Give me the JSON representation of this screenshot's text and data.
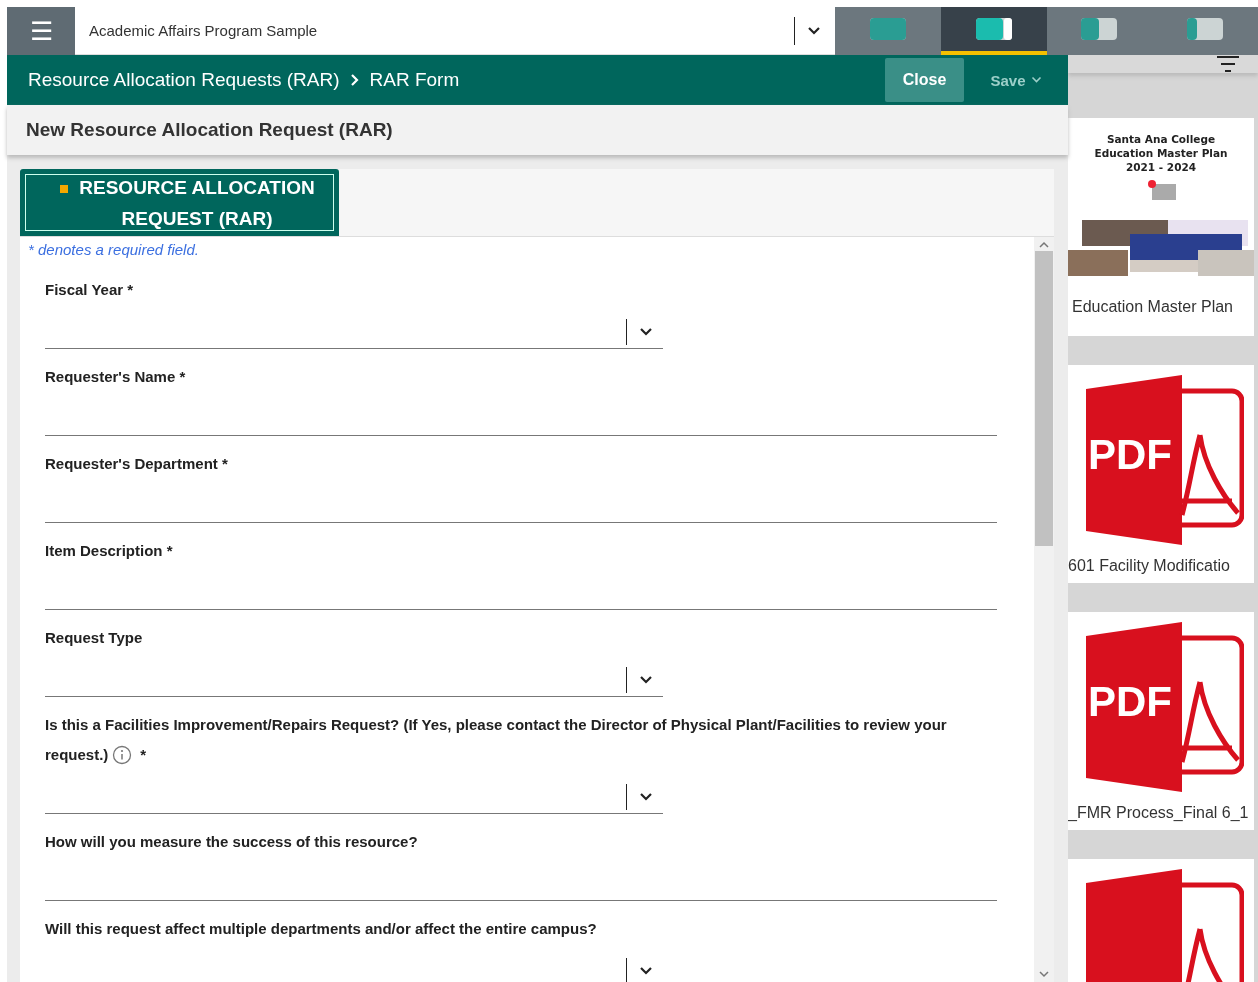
{
  "app_bar": {
    "menu_label": "☰",
    "program": "Academic Affairs Program Sample",
    "layout_tabs": [
      {
        "kind": "full",
        "selected": false
      },
      {
        "kind": "wide",
        "selected": true
      },
      {
        "kind": "split",
        "selected": false
      },
      {
        "kind": "narrow",
        "selected": false
      }
    ]
  },
  "header": {
    "breadcrumb": [
      "Resource Allocation Requests (RAR)",
      "RAR Form"
    ],
    "close": "Close",
    "save": "Save"
  },
  "page_title": "New Resource Allocation Request (RAR)",
  "form": {
    "tab": "RESOURCE ALLOCATION REQUEST (RAR)",
    "note": "* denotes a required field.",
    "fields": [
      {
        "kind": "select",
        "label": "Fiscal Year *"
      },
      {
        "kind": "text",
        "label": "Requester's Name *"
      },
      {
        "kind": "text",
        "label": "Requester's Department *"
      },
      {
        "kind": "text",
        "label": "Item Description *"
      },
      {
        "kind": "select",
        "label": "Request Type"
      },
      {
        "kind": "select",
        "label": "Is this a Facilities Improvement/Repairs Request? (If Yes, please contact the Director of Physical Plant/Facilities to review your",
        "label_end": "request.)",
        "info": true,
        "after": "*"
      },
      {
        "kind": "text",
        "label": "How will you measure the success of this resource?"
      },
      {
        "kind": "select",
        "label": "Will this request affect multiple departments and/or affect the entire campus?"
      }
    ]
  },
  "documents": [
    {
      "kind": "plan",
      "thumb_lines": [
        "Santa Ana College",
        "Education Master Plan",
        "2021 - 2024"
      ],
      "name": "Education Master Plan"
    },
    {
      "kind": "pdf",
      "icon_text": "PDF",
      "name": "601 Facility Modificatio"
    },
    {
      "kind": "pdf",
      "icon_text": "PDF",
      "name": "_FMR Process_Final 6_1"
    },
    {
      "kind": "pdf-cut"
    }
  ]
}
